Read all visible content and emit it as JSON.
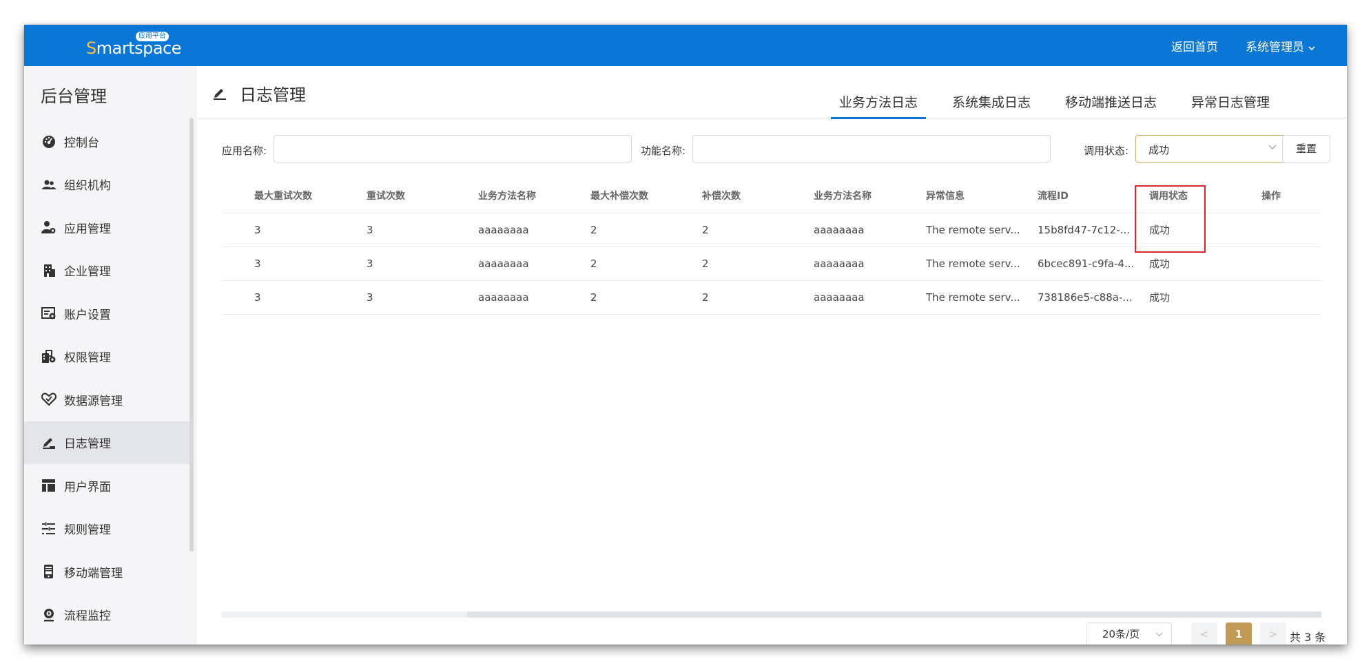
{
  "header": {
    "logo_text_s": "S",
    "logo_text_rest": "martspace",
    "logo_badge": "应用平台",
    "home_link": "返回首页",
    "user_menu": "系统管理员"
  },
  "sidebar": {
    "title": "后台管理",
    "items": [
      {
        "label": "控制台",
        "icon": "dashboard-icon"
      },
      {
        "label": "组织机构",
        "icon": "users-icon"
      },
      {
        "label": "应用管理",
        "icon": "user-settings-icon"
      },
      {
        "label": "企业管理",
        "icon": "building-icon"
      },
      {
        "label": "账户设置",
        "icon": "account-settings-icon"
      },
      {
        "label": "权限管理",
        "icon": "permission-icon"
      },
      {
        "label": "数据源管理",
        "icon": "heart-icon"
      },
      {
        "label": "日志管理",
        "icon": "edit-icon"
      },
      {
        "label": "用户界面",
        "icon": "layout-icon"
      },
      {
        "label": "规则管理",
        "icon": "rules-icon"
      },
      {
        "label": "移动端管理",
        "icon": "mobile-icon"
      },
      {
        "label": "流程监控",
        "icon": "webcam-icon"
      }
    ],
    "active_index": 7
  },
  "page": {
    "title": "日志管理",
    "tabs": [
      "业务方法日志",
      "系统集成日志",
      "移动端推送日志",
      "异常日志管理"
    ],
    "active_tab": 0
  },
  "filters": {
    "app_name_label": "应用名称:",
    "app_name_value": "",
    "func_name_label": "功能名称:",
    "func_name_value": "",
    "status_label": "调用状态:",
    "status_value": "成功",
    "reset_label": "重置"
  },
  "table": {
    "columns": [
      "最大重试次数",
      "重试次数",
      "业务方法名称",
      "最大补偿次数",
      "补偿次数",
      "业务方法名称",
      "异常信息",
      "流程ID",
      "调用状态",
      "操作"
    ],
    "rows": [
      [
        "3",
        "3",
        "aaaaaaaa",
        "2",
        "2",
        "aaaaaaaa",
        "The remote serv...",
        "15b8fd47-7c12-...",
        "成功",
        ""
      ],
      [
        "3",
        "3",
        "aaaaaaaa",
        "2",
        "2",
        "aaaaaaaa",
        "The remote serv...",
        "6bcec891-c9fa-4...",
        "成功",
        ""
      ],
      [
        "3",
        "3",
        "aaaaaaaa",
        "2",
        "2",
        "aaaaaaaa",
        "The remote serv...",
        "738186e5-c88a-...",
        "成功",
        ""
      ]
    ]
  },
  "pagination": {
    "page_size": "20条/页",
    "current_page": "1",
    "prev": "<",
    "next": ">",
    "total": "共 3 条"
  },
  "colors": {
    "header_bg": "#0a76d6",
    "accent": "#c19a56",
    "highlight": "#e0262b"
  }
}
